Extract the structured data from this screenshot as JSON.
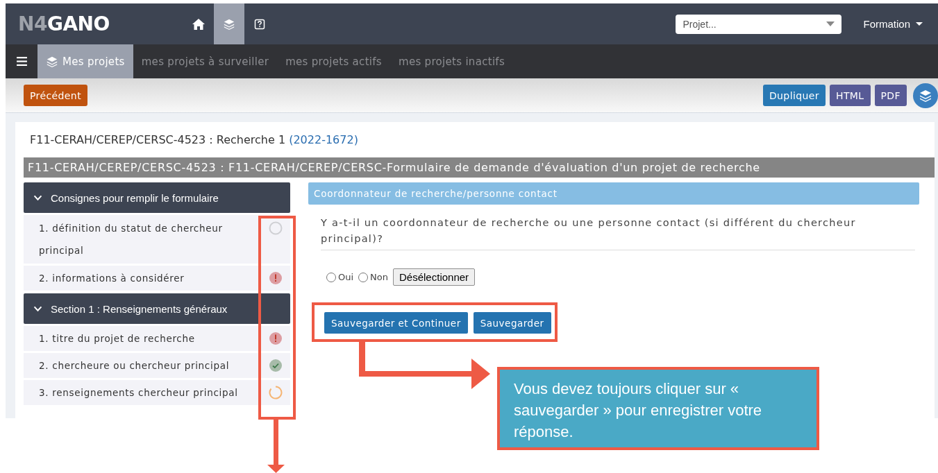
{
  "app": {
    "logo": [
      "N4",
      "GANO"
    ]
  },
  "top_nav": [
    {
      "kind": "home",
      "selected": false
    },
    {
      "kind": "layers",
      "selected": true
    },
    {
      "kind": "help",
      "selected": false
    }
  ],
  "project_select": {
    "placeholder": "Projet..."
  },
  "user_menu": {
    "label": "Formation"
  },
  "tabs": [
    {
      "label": "Mes projets",
      "selected": true
    },
    {
      "label": "mes projets à surveiller",
      "selected": false
    },
    {
      "label": "mes projets actifs",
      "selected": false
    },
    {
      "label": "mes projets inactifs",
      "selected": false
    }
  ],
  "toolbar": {
    "back_button": "Précédent",
    "actions": [
      {
        "label": "Dupliquer",
        "color": "#2878b4"
      },
      {
        "label": "HTML",
        "color": "#575a96"
      },
      {
        "label": "PDF",
        "color": "#575a96"
      }
    ]
  },
  "project_title": {
    "text": "F11-CERAH/CEREP/CERSC-4523 : Recherche 1",
    "link": "(2022-1672)"
  },
  "form_title": "F11-CERAH/CEREP/CERSC-4523 : F11-CERAH/CEREP/CERSC-Formulaire de demande d'évaluation d'un projet de recherche",
  "sections": [
    {
      "title": "Consignes pour remplir le formulaire",
      "expanded": true,
      "items": [
        {
          "label": "1. définition du statut de chercheur principal",
          "kind": "empty"
        },
        {
          "label": "2. informations à considérer",
          "kind": "error"
        }
      ]
    },
    {
      "title": "Section 1 : Renseignements généraux",
      "expanded": true,
      "items": [
        {
          "label": "1. titre du projet de recherche",
          "kind": "error"
        },
        {
          "label": "2. chercheure ou chercheur principal",
          "kind": "done"
        },
        {
          "label": "3. renseignements chercheur principal",
          "kind": "partial"
        }
      ]
    }
  ],
  "question_group": {
    "title": "Coordonnateur de recherche/personne contact",
    "question": "Y a-t-il un coordonnateur de recherche ou une personne contact (si différent du chercheur principal)?",
    "options": [
      {
        "label": "Oui",
        "selected": false
      },
      {
        "label": "Non",
        "selected": false
      }
    ],
    "clear_button": "Désélectionner",
    "buttons": [
      "Sauvegarder et Continuer",
      "Sauvegarder"
    ]
  },
  "annotation": {
    "callout": "Vous devez toujours cliquer sur « sauvegarder » pour enregistrer votre réponse."
  }
}
